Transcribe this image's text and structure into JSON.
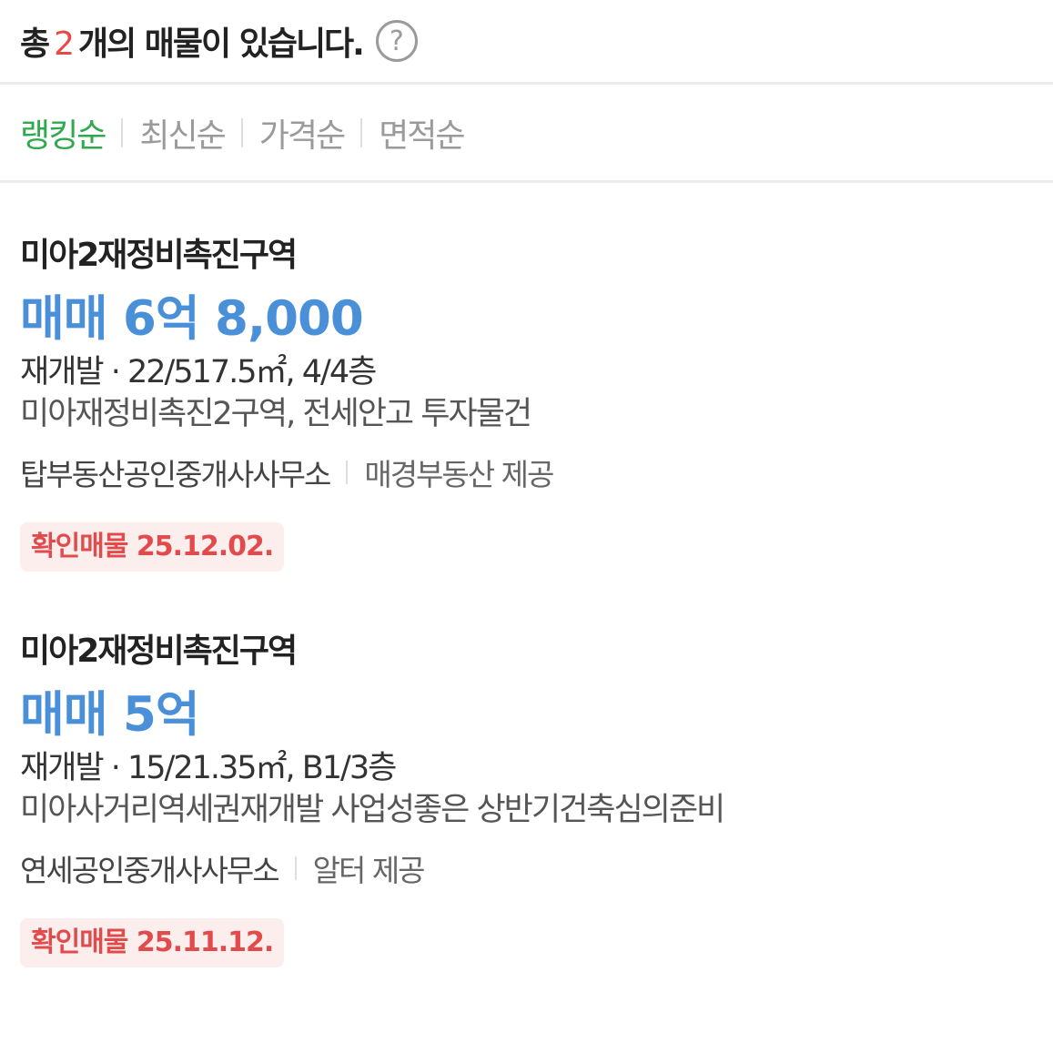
{
  "header": {
    "prefix": "총",
    "count": "2",
    "suffix": "개의 매물이 있습니다.",
    "help_icon": "question-circle-icon"
  },
  "sort": {
    "items": [
      {
        "label": "랭킹순",
        "active": true
      },
      {
        "label": "최신순",
        "active": false
      },
      {
        "label": "가격순",
        "active": false
      },
      {
        "label": "면적순",
        "active": false
      }
    ],
    "active_color": "#2fa94d",
    "inactive_color": "#9a9a9a"
  },
  "listings": [
    {
      "complex": "미아2재정비촉진구역",
      "price": "매매 6억 8,000",
      "type": "재개발",
      "spec": " · 22/517.5㎡, 4/4층",
      "desc": "미아재정비촉진2구역, 전세안고 투자물건",
      "agency": "탑부동산공인중개사사무소",
      "provider": "매경부동산 제공",
      "badge": "확인매물 25.12.02."
    },
    {
      "complex": "미아2재정비촉진구역",
      "price": "매매 5억",
      "type": "재개발",
      "spec": " · 15/21.35㎡, B1/3층",
      "desc": "미아사거리역세권재개발 사업성좋은 상반기건축심의준비",
      "agency": "연세공인중개사사무소",
      "provider": "알터 제공",
      "badge": "확인매물 25.11.12."
    }
  ],
  "colors": {
    "price": "#4a90d9",
    "count": "#e84848",
    "badge_text": "#e24b4b",
    "badge_bg": "#fdeeee"
  }
}
